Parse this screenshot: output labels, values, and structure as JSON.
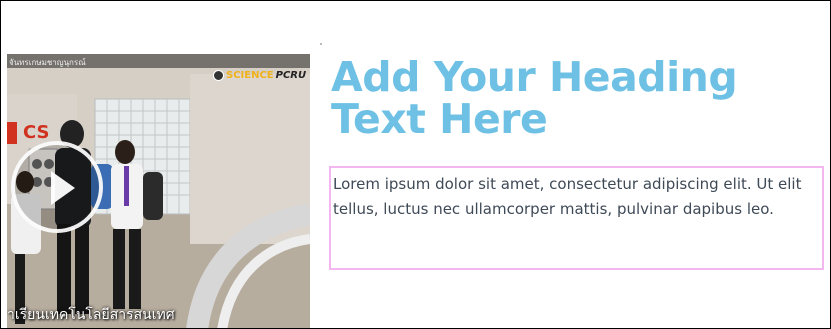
{
  "video": {
    "channel_text": "จันทรเกษมชาญนุกรณ์",
    "logo_science": "SCIENCE",
    "logo_pcru": "PCRU",
    "sign_text": "CS",
    "caption": "าเรียนเทคโนโลยีสารสนเทศ"
  },
  "heading": {
    "text": "Add Your Heading Text Here",
    "color": "#6ec1e4"
  },
  "body": {
    "text": "Lorem ipsum dolor sit amet, consectetur adipiscing elit. Ut elit tellus, luctus nec ullamcorper mattis, pulvinar dapibus leo."
  }
}
